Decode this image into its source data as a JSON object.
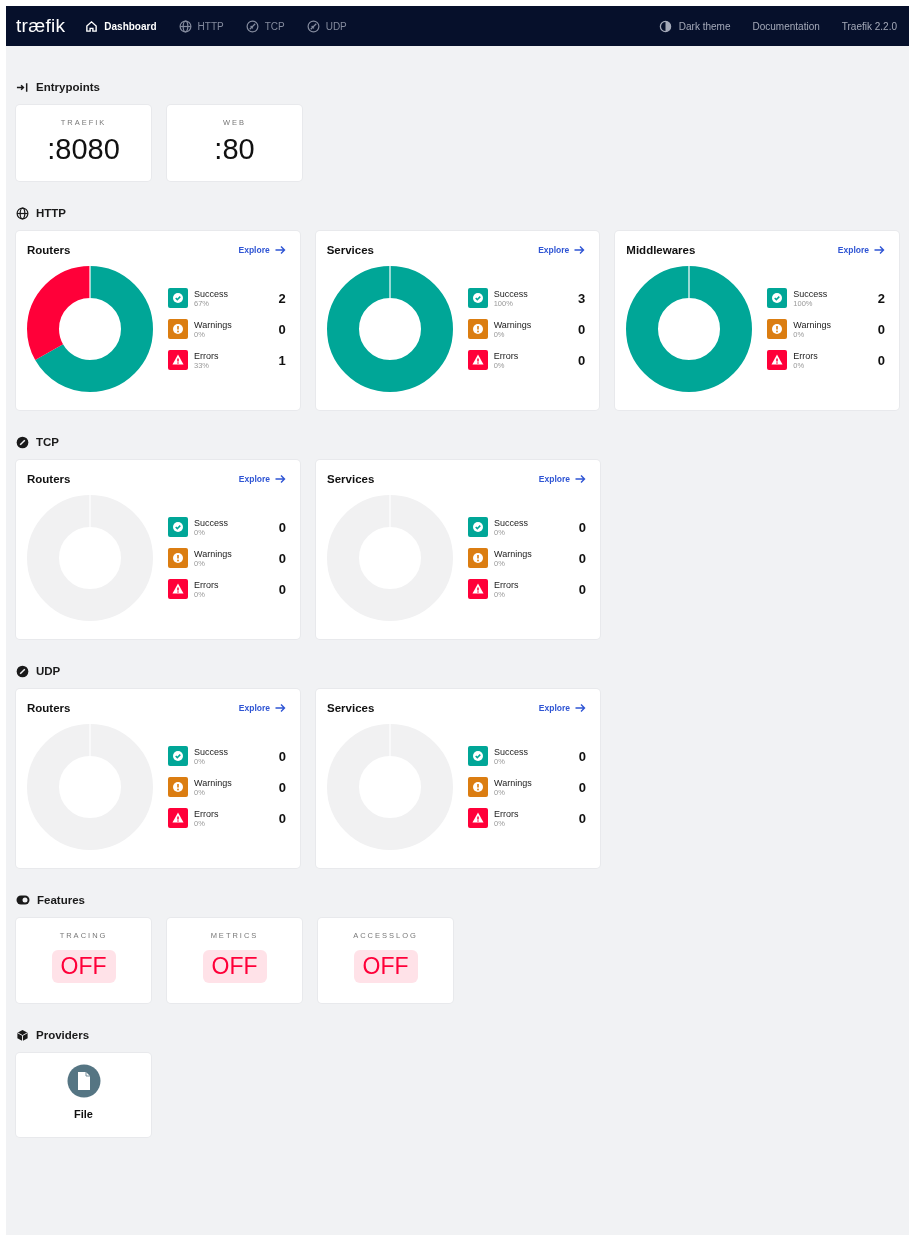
{
  "navbar": {
    "logo": "træfik",
    "items": [
      {
        "label": "Dashboard",
        "selected": true
      },
      {
        "label": "HTTP",
        "selected": false
      },
      {
        "label": "TCP",
        "selected": false
      },
      {
        "label": "UDP",
        "selected": false
      }
    ],
    "right": [
      {
        "label": "Dark theme"
      },
      {
        "label": "Documentation"
      },
      {
        "label": "Traefik 2.2.0"
      }
    ]
  },
  "sections": [
    {
      "title": "Entrypoints",
      "kind": "entrypoints",
      "items": [
        {
          "name": "TRAEFIK",
          "value": ":8080"
        },
        {
          "name": "WEB",
          "value": ":80"
        }
      ]
    },
    {
      "title": "HTTP",
      "kind": "stats",
      "items": [
        {
          "title": "Routers",
          "link": "Explore",
          "stats": [
            {
              "kind": "success",
              "label": "Success",
              "percent": "67%",
              "count": "2"
            },
            {
              "kind": "warning",
              "label": "Warnings",
              "percent": "0%",
              "count": "0"
            },
            {
              "kind": "error",
              "label": "Errors",
              "percent": "33%",
              "count": "1"
            }
          ]
        },
        {
          "title": "Services",
          "link": "Explore",
          "stats": [
            {
              "kind": "success",
              "label": "Success",
              "percent": "100%",
              "count": "3"
            },
            {
              "kind": "warning",
              "label": "Warnings",
              "percent": "0%",
              "count": "0"
            },
            {
              "kind": "error",
              "label": "Errors",
              "percent": "0%",
              "count": "0"
            }
          ]
        },
        {
          "title": "Middlewares",
          "link": "Explore",
          "stats": [
            {
              "kind": "success",
              "label": "Success",
              "percent": "100%",
              "count": "2"
            },
            {
              "kind": "warning",
              "label": "Warnings",
              "percent": "0%",
              "count": "0"
            },
            {
              "kind": "error",
              "label": "Errors",
              "percent": "0%",
              "count": "0"
            }
          ]
        }
      ]
    },
    {
      "title": "TCP",
      "kind": "stats",
      "items": [
        {
          "title": "Routers",
          "link": "Explore",
          "stats": [
            {
              "kind": "success",
              "label": "Success",
              "percent": "0%",
              "count": "0"
            },
            {
              "kind": "warning",
              "label": "Warnings",
              "percent": "0%",
              "count": "0"
            },
            {
              "kind": "error",
              "label": "Errors",
              "percent": "0%",
              "count": "0"
            }
          ]
        },
        {
          "title": "Services",
          "link": "Explore",
          "stats": [
            {
              "kind": "success",
              "label": "Success",
              "percent": "0%",
              "count": "0"
            },
            {
              "kind": "warning",
              "label": "Warnings",
              "percent": "0%",
              "count": "0"
            },
            {
              "kind": "error",
              "label": "Errors",
              "percent": "0%",
              "count": "0"
            }
          ]
        }
      ]
    },
    {
      "title": "UDP",
      "kind": "stats",
      "items": [
        {
          "title": "Routers",
          "link": "Explore",
          "stats": [
            {
              "kind": "success",
              "label": "Success",
              "percent": "0%",
              "count": "0"
            },
            {
              "kind": "warning",
              "label": "Warnings",
              "percent": "0%",
              "count": "0"
            },
            {
              "kind": "error",
              "label": "Errors",
              "percent": "0%",
              "count": "0"
            }
          ]
        },
        {
          "title": "Services",
          "link": "Explore",
          "stats": [
            {
              "kind": "success",
              "label": "Success",
              "percent": "0%",
              "count": "0"
            },
            {
              "kind": "warning",
              "label": "Warnings",
              "percent": "0%",
              "count": "0"
            },
            {
              "kind": "error",
              "label": "Errors",
              "percent": "0%",
              "count": "0"
            }
          ]
        }
      ]
    },
    {
      "title": "Features",
      "kind": "features",
      "items": [
        {
          "name": "TRACING",
          "value": "OFF",
          "on": false
        },
        {
          "name": "METRICS",
          "value": "OFF",
          "on": false
        },
        {
          "name": "ACCESSLOG",
          "value": "OFF",
          "on": false
        }
      ]
    },
    {
      "title": "Providers",
      "kind": "providers",
      "items": [
        {
          "name": "File"
        }
      ]
    }
  ]
}
